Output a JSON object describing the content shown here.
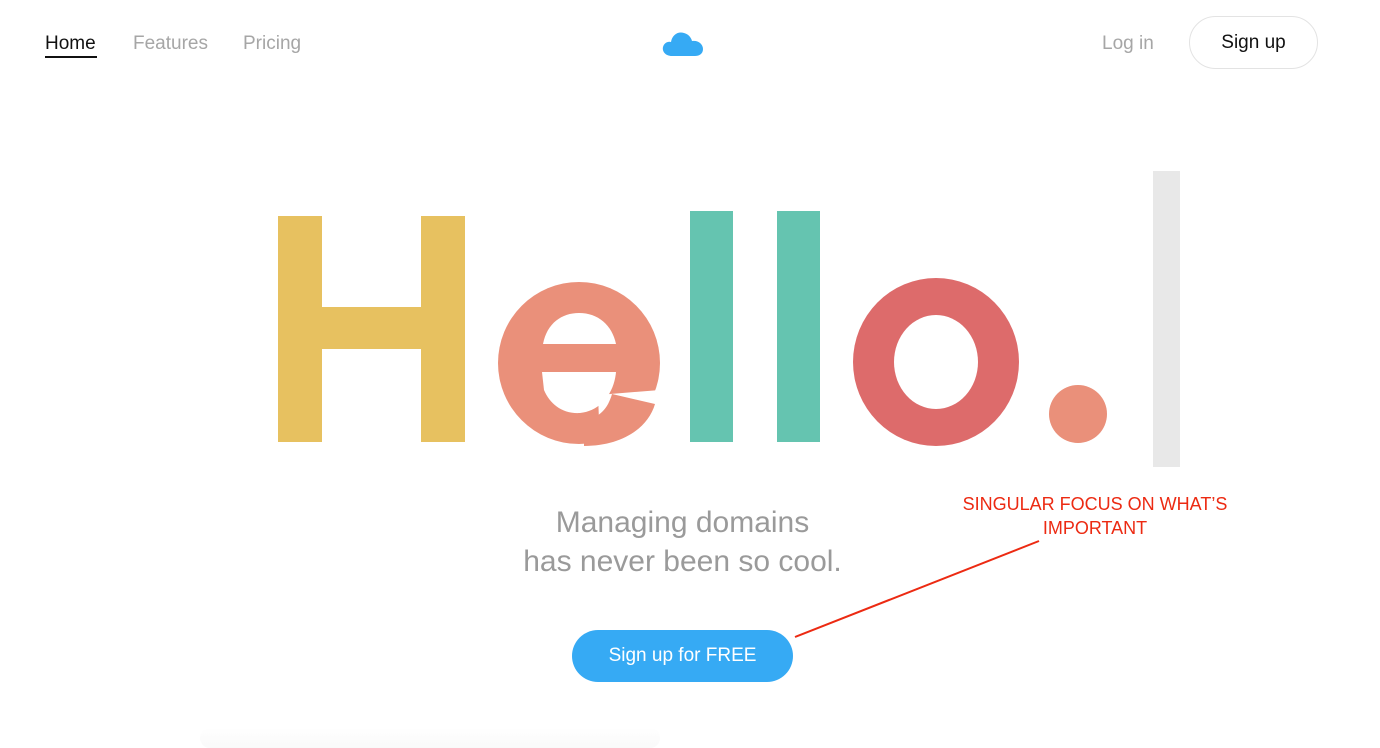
{
  "nav": {
    "home": "Home",
    "features": "Features",
    "pricing": "Pricing",
    "login": "Log in",
    "signup": "Sign up"
  },
  "logo": {
    "icon": "cloud-icon",
    "color": "#36aaf4"
  },
  "hero": {
    "headline_letters": [
      "H",
      "e",
      "l",
      "l",
      "o",
      "."
    ],
    "headline_colors": [
      "#e7c160",
      "#ea907a",
      "#65c4b0",
      "#65c4b0",
      "#dd6b6b",
      "#ea907a"
    ],
    "cursor_color": "#e8e8e8",
    "tagline_line1": "Managing domains",
    "tagline_line2": "has never been so cool.",
    "cta_label": "Sign up for FREE",
    "cta_color": "#36aaf4"
  },
  "annotation": {
    "line1": "SINGULAR FOCUS ON WHAT’S",
    "line2": "IMPORTANT",
    "color": "#ec2a12"
  }
}
